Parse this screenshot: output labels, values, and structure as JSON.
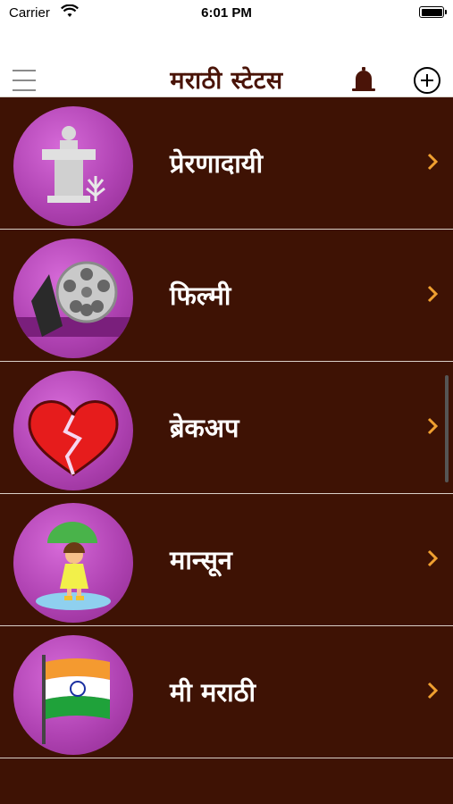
{
  "status": {
    "carrier": "Carrier",
    "time": "6:01 PM"
  },
  "header": {
    "title": "मराठी स्टेटस",
    "menu_icon": "hamburger-icon",
    "bell_icon": "bell-icon",
    "add_icon": "plus-circle-icon"
  },
  "colors": {
    "background": "#3e1204",
    "title": "#4a1408",
    "chevron": "#f0a030",
    "thumb": "#b043b3",
    "separator": "#d9cfc8"
  },
  "categories": [
    {
      "label": "प्रेरणादायी",
      "icon": "podium-icon"
    },
    {
      "label": "फिल्मी",
      "icon": "film-reel-icon"
    },
    {
      "label": "ब्रेकअप",
      "icon": "broken-heart-icon"
    },
    {
      "label": "मान्सून",
      "icon": "umbrella-girl-icon"
    },
    {
      "label": "मी मराठी",
      "icon": "india-flag-icon"
    }
  ]
}
